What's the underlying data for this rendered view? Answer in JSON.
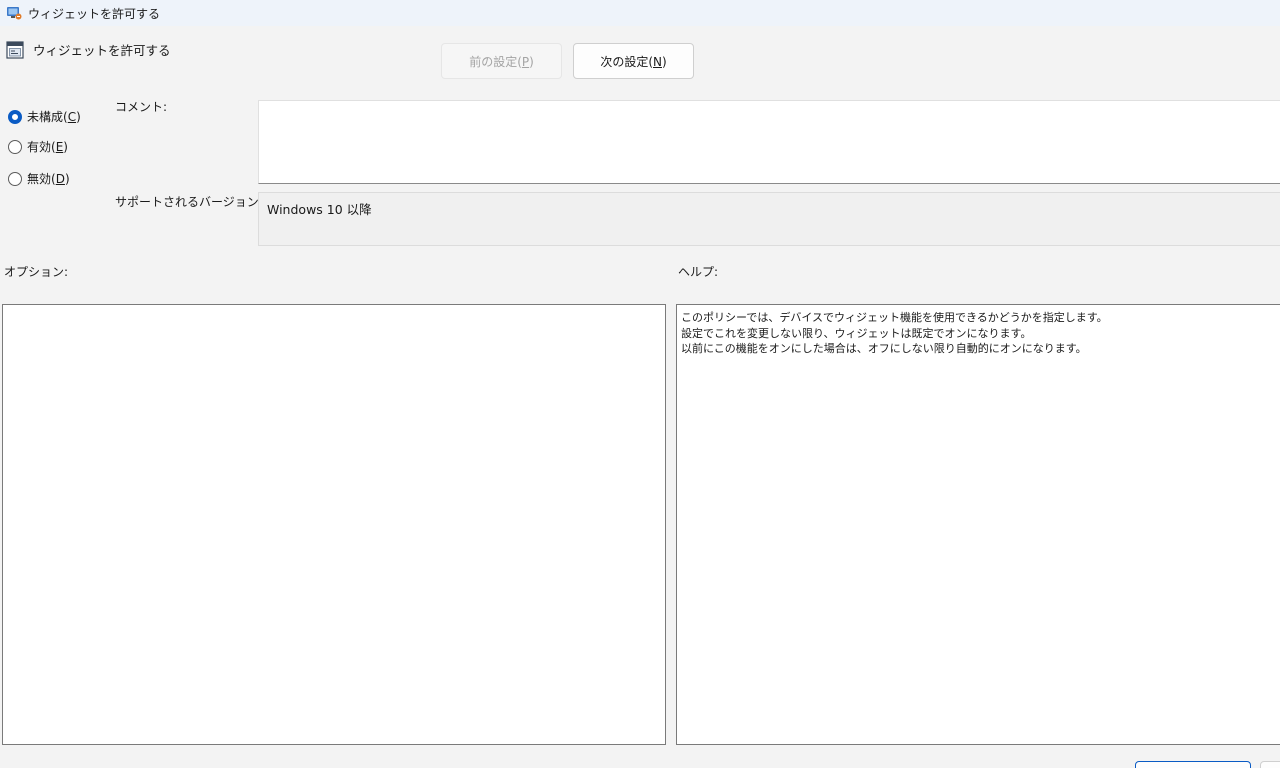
{
  "window": {
    "title": "ウィジェットを許可する"
  },
  "header": {
    "policy_name": "ウィジェットを許可する",
    "prev_button": {
      "text": "前の設定(",
      "key": "P",
      "suffix": ")"
    },
    "next_button": {
      "text": "次の設定(",
      "key": "N",
      "suffix": ")"
    }
  },
  "state_options": [
    {
      "text": "未構成(",
      "key": "C",
      "suffix": ")",
      "selected": true
    },
    {
      "text": "有効(",
      "key": "E",
      "suffix": ")",
      "selected": false
    },
    {
      "text": "無効(",
      "key": "D",
      "suffix": ")",
      "selected": false
    }
  ],
  "comment": {
    "label": "コメント:",
    "value": ""
  },
  "supported_versions": {
    "label": "サポートされるバージョン:",
    "value": "Windows 10 以降"
  },
  "options": {
    "label": "オプション:"
  },
  "help": {
    "label": "ヘルプ:",
    "lines": [
      "このポリシーでは、デバイスでウィジェット機能を使用できるかどうかを指定します。",
      "設定でこれを変更しない限り、ウィジェットは既定でオンになります。",
      "以前にこの機能をオンにした場合は、オフにしない限り自動的にオンになります。"
    ]
  },
  "colors": {
    "accent": "#0a5bc4",
    "background": "#f3f3f3"
  }
}
